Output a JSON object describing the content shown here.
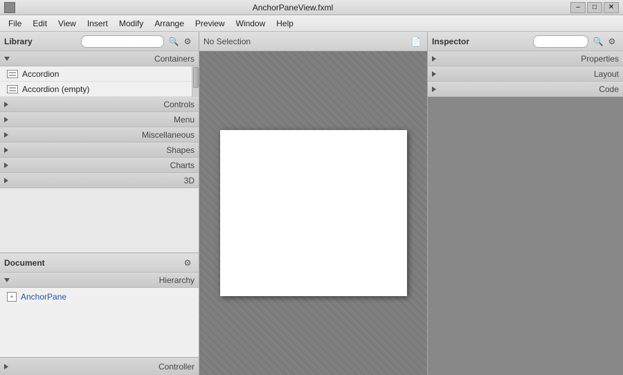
{
  "titlebar": {
    "title": "AnchorPaneView.fxml",
    "icon": "file-icon",
    "minimize_label": "–",
    "maximize_label": "□",
    "close_label": "✕"
  },
  "menubar": {
    "items": [
      {
        "id": "file",
        "label": "File"
      },
      {
        "id": "edit",
        "label": "Edit"
      },
      {
        "id": "view",
        "label": "View"
      },
      {
        "id": "insert",
        "label": "Insert"
      },
      {
        "id": "modify",
        "label": "Modify"
      },
      {
        "id": "arrange",
        "label": "Arrange"
      },
      {
        "id": "preview",
        "label": "Preview"
      },
      {
        "id": "window",
        "label": "Window"
      },
      {
        "id": "help",
        "label": "Help"
      }
    ]
  },
  "library": {
    "title": "Library",
    "search_placeholder": "",
    "categories": {
      "containers": {
        "label": "Containers",
        "expanded": true,
        "items": [
          {
            "label": "Accordion"
          },
          {
            "label": "Accordion  (empty)"
          }
        ]
      },
      "controls": {
        "label": "Controls",
        "expanded": false
      },
      "menu": {
        "label": "Menu",
        "expanded": false
      },
      "miscellaneous": {
        "label": "Miscellaneous",
        "expanded": false
      },
      "shapes": {
        "label": "Shapes",
        "expanded": false
      },
      "charts": {
        "label": "Charts",
        "expanded": false
      },
      "three_d": {
        "label": "3D",
        "expanded": false
      }
    }
  },
  "canvas": {
    "no_selection_label": "No Selection",
    "doc_icon": "document-icon"
  },
  "inspector": {
    "title": "Inspector",
    "sections": [
      {
        "label": "Properties"
      },
      {
        "label": "Layout"
      },
      {
        "label": "Code"
      }
    ]
  },
  "document": {
    "title": "Document",
    "settings_icon": "gear-icon",
    "hierarchy_label": "Hierarchy",
    "items": [
      {
        "label": "AnchorPane",
        "icon": "anchor-icon"
      }
    ]
  },
  "controller": {
    "label": "Controller",
    "triangle": "right"
  }
}
